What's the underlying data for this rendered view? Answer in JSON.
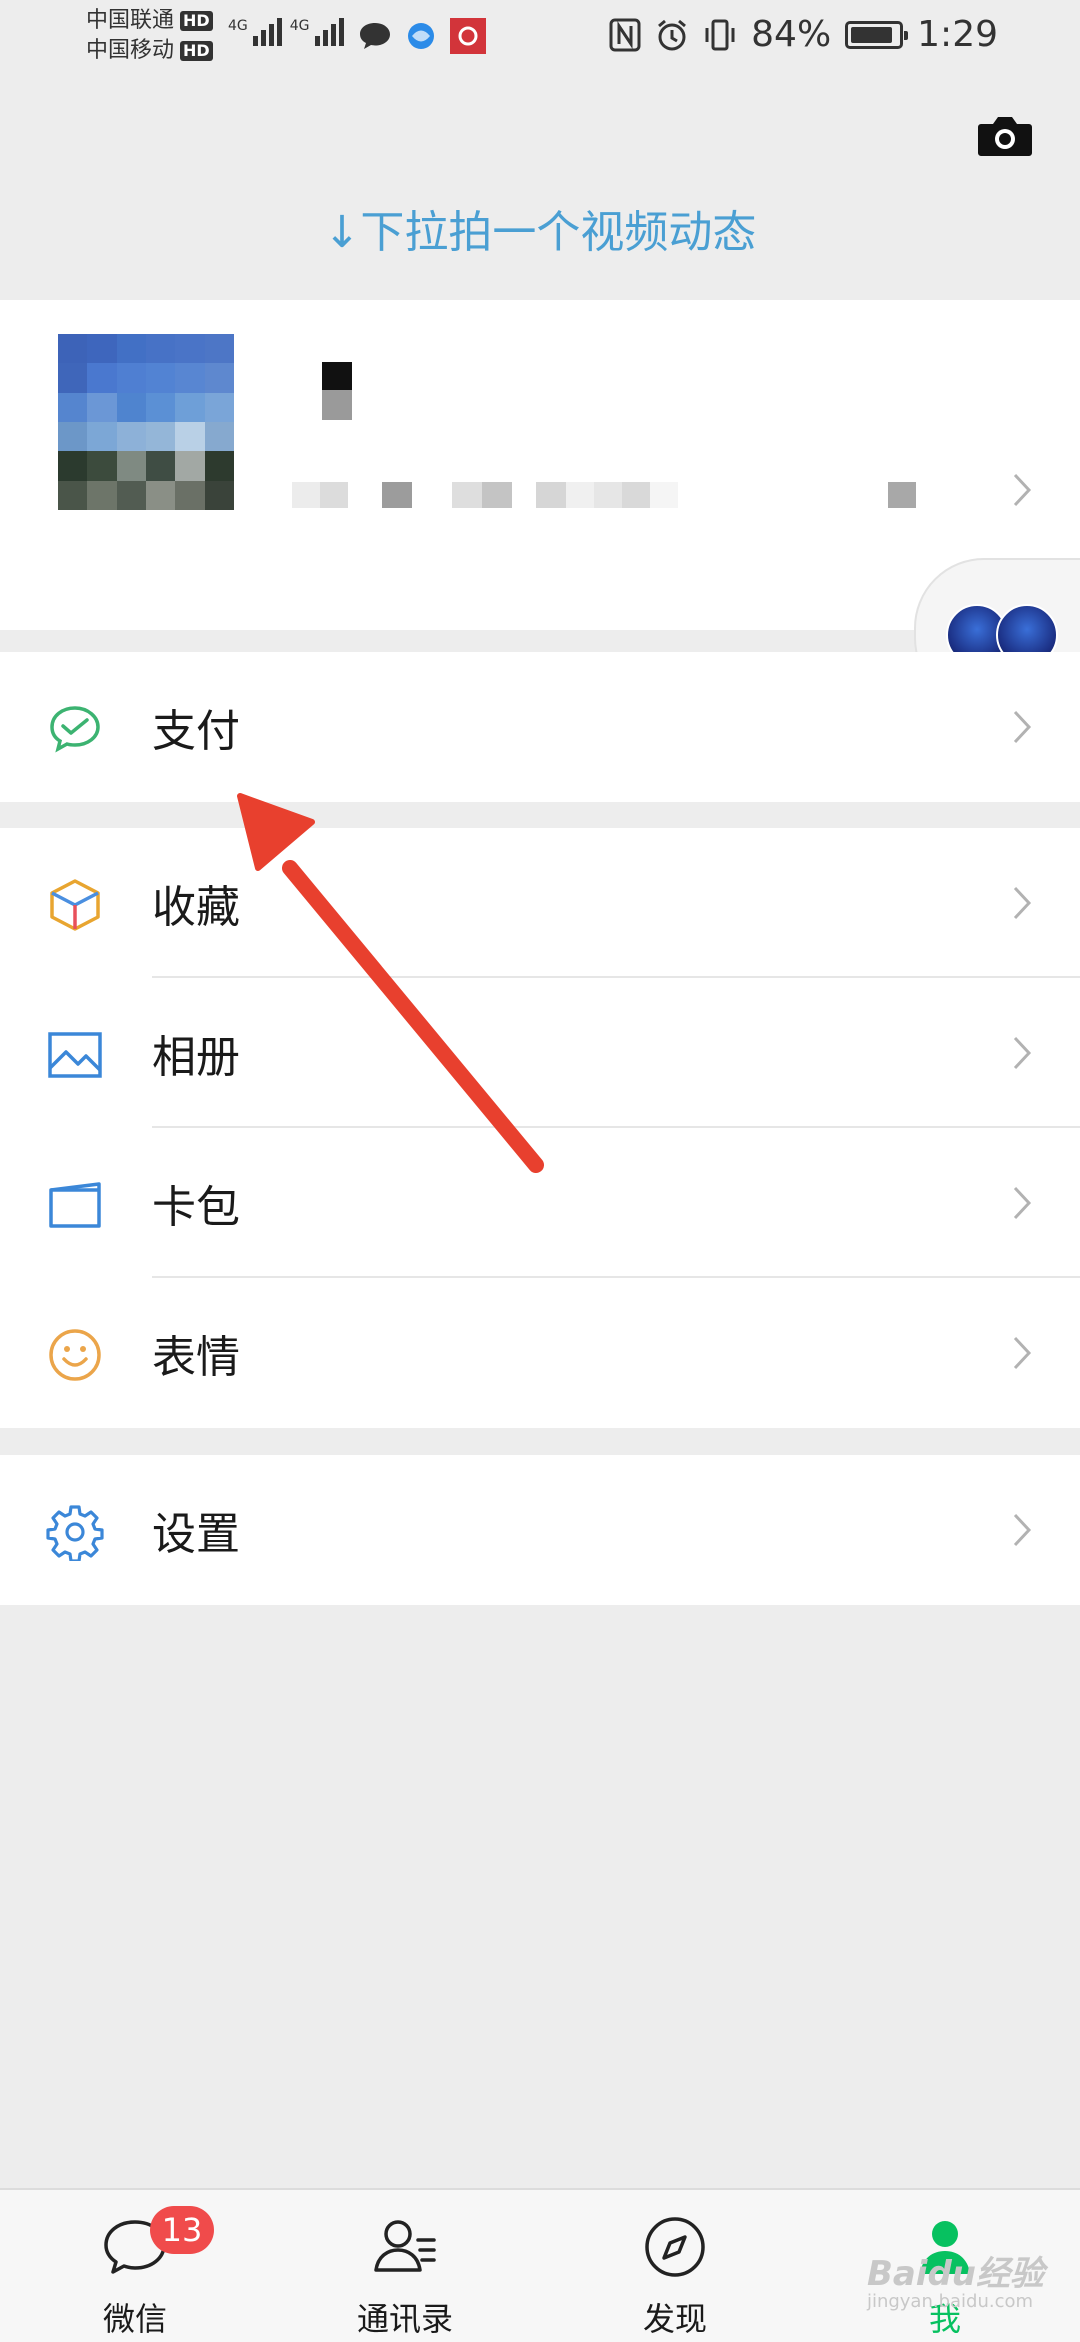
{
  "status_bar": {
    "carrier_1": "中国联通",
    "carrier_2": "中国移动",
    "hd_badge": "HD",
    "network_type": "4G",
    "battery_percent": "84%",
    "time": "1:29"
  },
  "header": {
    "pull_hint": "↓下拉拍一个视频动态"
  },
  "menu": {
    "pay": {
      "label": "支付",
      "icon": "wechat-pay-icon"
    },
    "favorites": {
      "label": "收藏",
      "icon": "cube-icon"
    },
    "album": {
      "label": "相册",
      "icon": "picture-icon"
    },
    "cards": {
      "label": "卡包",
      "icon": "wallet-card-icon"
    },
    "stickers": {
      "label": "表情",
      "icon": "smiley-icon"
    },
    "settings": {
      "label": "设置",
      "icon": "gear-icon"
    }
  },
  "bottom_nav": {
    "chats": {
      "label": "微信",
      "badge": "13"
    },
    "contacts": {
      "label": "通讯录"
    },
    "discover": {
      "label": "发现"
    },
    "me": {
      "label": "我"
    }
  },
  "watermark": {
    "brand": "Baidu经验",
    "url": "jingyan.baidu.com"
  },
  "colors": {
    "accent_blue": "#4a9fd3",
    "wechat_green": "#07c160",
    "badge_red": "#f04b4b",
    "annotation_red": "#e8402e",
    "background": "#ededed"
  }
}
